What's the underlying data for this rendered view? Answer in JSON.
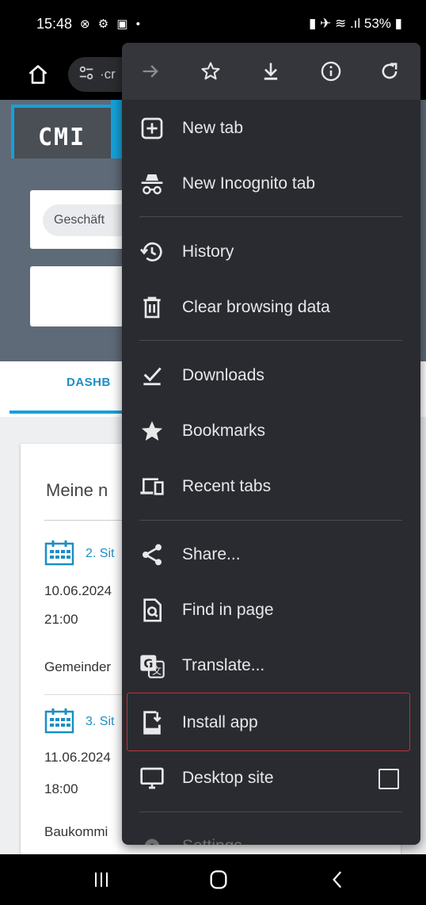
{
  "status_bar": {
    "time": "15:48",
    "left_icons": "⊗ ⚙ ▣ •",
    "right_text": "▮ ✈ ≋ .ıl 53% ▮"
  },
  "browser": {
    "url_text": "·cr"
  },
  "page": {
    "logo": "CMI",
    "search_placeholder": "Geschäft",
    "tab_label": "DASHB",
    "card_title": "Meine n",
    "events": [
      {
        "link": "2. Sit",
        "date": "10.06.2024",
        "time": "21:00",
        "body": "Gemeinder"
      },
      {
        "link": "3. Sit",
        "date": "11.06.2024",
        "time": "18:00",
        "body": "Baukommi"
      }
    ]
  },
  "menu": {
    "top_icons": [
      "forward-icon",
      "star-icon",
      "download-icon",
      "info-icon",
      "reload-icon"
    ],
    "items": [
      {
        "label": "New tab",
        "icon": "new-tab-icon"
      },
      {
        "label": "New Incognito tab",
        "icon": "incognito-icon"
      },
      {
        "label": "History",
        "icon": "history-icon"
      },
      {
        "label": "Clear browsing data",
        "icon": "trash-icon"
      },
      {
        "label": "Downloads",
        "icon": "downloads-check-icon"
      },
      {
        "label": "Bookmarks",
        "icon": "bookmark-star-icon"
      },
      {
        "label": "Recent tabs",
        "icon": "devices-icon"
      },
      {
        "label": "Share...",
        "icon": "share-icon"
      },
      {
        "label": "Find in page",
        "icon": "find-icon"
      },
      {
        "label": "Translate...",
        "icon": "translate-icon"
      },
      {
        "label": "Install app",
        "icon": "install-app-icon"
      },
      {
        "label": "Desktop site",
        "icon": "desktop-icon",
        "checked": false
      },
      {
        "label": "Settings",
        "icon": "gear-icon"
      }
    ],
    "highlight_color": "#c0303a"
  },
  "colors": {
    "accent": "#15a1d9",
    "menu_bg": "#2a2b30",
    "header_bg": "#5f6a78"
  }
}
